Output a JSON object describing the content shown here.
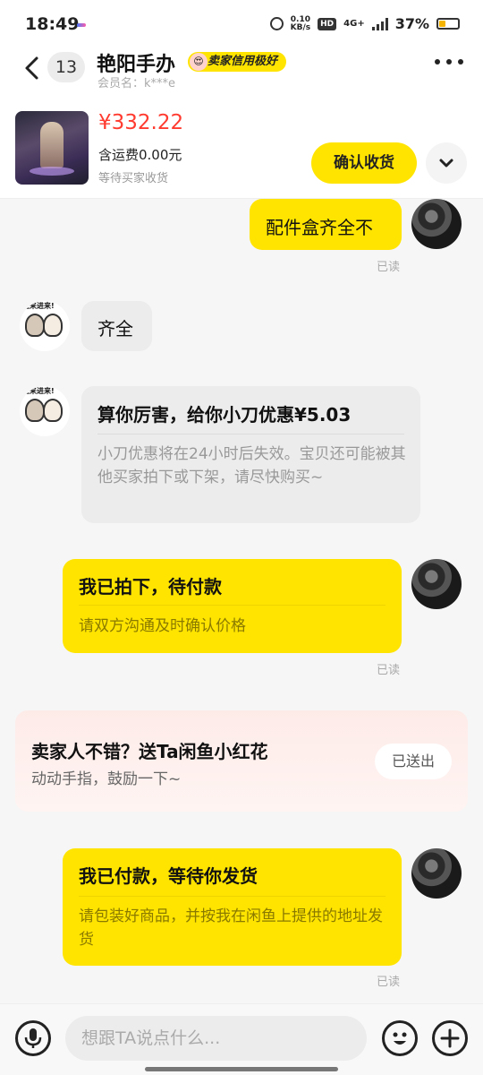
{
  "status_bar": {
    "time": "18:49",
    "net_speed_value": "0.10",
    "net_speed_unit": "KB/s",
    "hd_label": "HD",
    "network": "4G+",
    "battery_percent": "37%",
    "battery_level": 0.37
  },
  "header": {
    "unread_count": "13",
    "seller_name": "艳阳手办",
    "credit_badge": "卖家信用极好",
    "member_label": "会员名：k***e",
    "more_icon": "more-dots-icon",
    "back_icon": "chevron-left-icon"
  },
  "product": {
    "price": "¥332.22",
    "shipping": "含运费0.00元",
    "status": "等待买家收货",
    "confirm_label": "确认收货",
    "expand_icon": "chevron-down-icon"
  },
  "messages": {
    "m1_text": "配件盒齐全不",
    "m1_read": "已读",
    "m2_text": "齐全",
    "seller_avatar_text": "进来进来!",
    "m3_title": "算你厉害，给你小刀优惠¥5.03",
    "m3_desc": "小刀优惠将在24小时后失效。宝贝还可能被其他买家拍下或下架，请尽快购买~",
    "m4_title": "我已拍下，待付款",
    "m4_desc": "请双方沟通及时确认价格",
    "m4_read": "已读",
    "flower_title": "卖家人不错？送Ta闲鱼小红花",
    "flower_sub": "动动手指，鼓励一下~",
    "flower_button": "已送出",
    "m5_title": "我已付款，等待你发货",
    "m5_desc": "请包装好商品，并按我在闲鱼上提供的地址发货",
    "m5_read": "已读"
  },
  "input_bar": {
    "placeholder": "想跟TA说点什么...",
    "voice_icon": "microphone-icon",
    "emoji_icon": "emoji-icon",
    "plus_icon": "plus-icon"
  },
  "colors": {
    "accent_yellow": "#ffe400",
    "price_red": "#ff3b30",
    "background": "#f6f6f6"
  }
}
